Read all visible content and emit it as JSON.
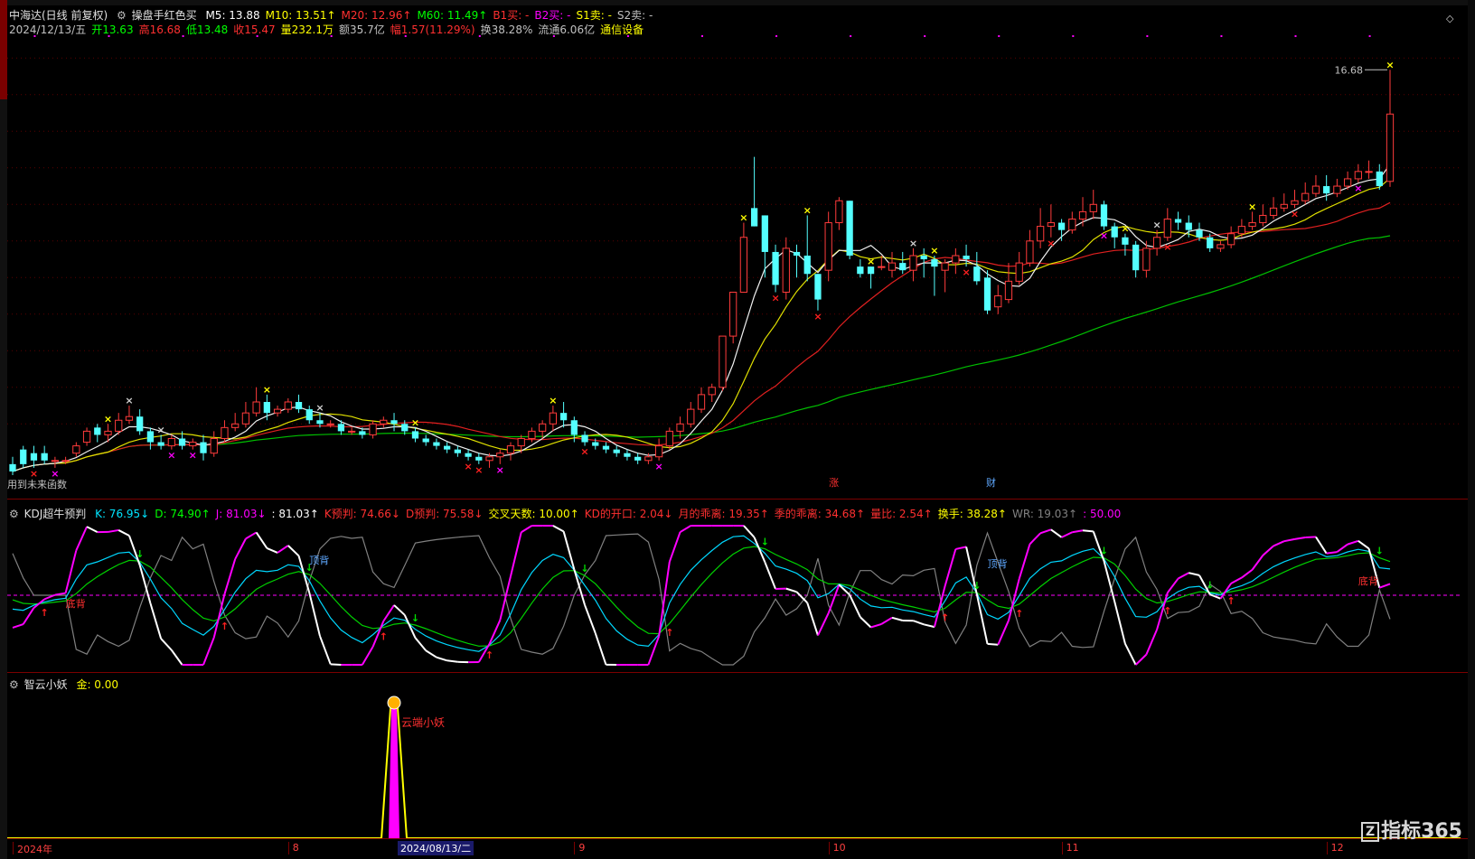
{
  "header": {
    "title": "中海达(日线 前复权)",
    "formula_name": "操盘手红色买",
    "ma": [
      {
        "label": "M5: 13.88",
        "color": "#ffffff"
      },
      {
        "label": "M10: 13.51",
        "arrow": "↑",
        "color": "#ffff00"
      },
      {
        "label": "M20: 12.96",
        "arrow": "↑",
        "color": "#ff3030"
      },
      {
        "label": "M60: 11.49",
        "arrow": "↑",
        "color": "#00ff00"
      },
      {
        "label": "B1买: -",
        "color": "#ff3030"
      },
      {
        "label": "B2买: -",
        "color": "#ff00ff"
      },
      {
        "label": "S1卖: -",
        "color": "#ffff00"
      },
      {
        "label": "S2卖: -",
        "color": "#c0c0c0"
      }
    ],
    "quote": [
      {
        "label": "2024/12/13/五",
        "color": "#c0c0c0"
      },
      {
        "label": "开13.63",
        "color": "#00ff00"
      },
      {
        "label": "高16.68",
        "color": "#ff3030"
      },
      {
        "label": "低13.48",
        "color": "#00ff00"
      },
      {
        "label": "收15.47",
        "color": "#ff3030"
      },
      {
        "label": "量232.1万",
        "color": "#ffff00"
      },
      {
        "label": "额35.7亿",
        "color": "#c0c0c0"
      },
      {
        "label": "幅1.57(11.29%)",
        "color": "#ff3030"
      },
      {
        "label": "换38.28%",
        "color": "#c0c0c0"
      },
      {
        "label": "流通6.06亿",
        "color": "#c0c0c0"
      },
      {
        "label": "通信设备",
        "color": "#ffff00"
      }
    ],
    "high_label": "16.68",
    "bottom_left_note": "用到未来函数"
  },
  "kdj_panel": {
    "name": "KDJ超牛预判",
    "items": [
      {
        "label": "K: 76.95",
        "arrow": "↓",
        "color": "#00e5ff"
      },
      {
        "label": "D: 74.90",
        "arrow": "↑",
        "color": "#00ff00"
      },
      {
        "label": "J: 81.03",
        "arrow": "↓",
        "color": "#ff00ff"
      },
      {
        "label": ": 81.03",
        "arrow": "↑",
        "color": "#ffffff"
      },
      {
        "label": "K预判: 74.66",
        "arrow": "↓",
        "color": "#ff3030"
      },
      {
        "label": "D预判: 75.58",
        "arrow": "↓",
        "color": "#ff3030"
      },
      {
        "label": "交叉天数: 10.00",
        "arrow": "↑",
        "color": "#ffff00"
      },
      {
        "label": "KD的开口: 2.04",
        "arrow": "↓",
        "color": "#ff3030"
      },
      {
        "label": "月的乖离: 19.35",
        "arrow": "↑",
        "color": "#ff3030"
      },
      {
        "label": "季的乖离: 34.68",
        "arrow": "↑",
        "color": "#ff3030"
      },
      {
        "label": "量比: 2.54",
        "arrow": "↑",
        "color": "#ff3030"
      },
      {
        "label": "换手: 38.28",
        "arrow": "↑",
        "color": "#ffff00"
      },
      {
        "label": "WR: 19.03",
        "arrow": "↑",
        "color": "#808080"
      },
      {
        "label": ": 50.00",
        "color": "#ff00ff"
      }
    ],
    "labels": {
      "bottom_div": "底背",
      "top_div": "顶背"
    }
  },
  "zy_panel": {
    "name": "智云小妖",
    "value": "金: 0.00",
    "signal_label": "云端小妖"
  },
  "markers": {
    "zhang": "涨",
    "cai": "财"
  },
  "x_axis": {
    "labels": [
      {
        "text": "2024年",
        "bar": 0
      },
      {
        "text": "8",
        "bar": 26
      },
      {
        "text": "9",
        "bar": 53
      },
      {
        "text": "10",
        "bar": 77
      },
      {
        "text": "11",
        "bar": 99
      },
      {
        "text": "12",
        "bar": 124
      }
    ],
    "cursor_label": "2024/08/13/二"
  },
  "watermark": "指标365",
  "chart_data": {
    "type": "candlestick",
    "title": "中海达(日线 前复权)",
    "ylim": [
      5.6,
      17.6
    ],
    "candles": [
      [
        5.9,
        5.7,
        6.1,
        5.6
      ],
      [
        6.3,
        5.9,
        6.4,
        5.8
      ],
      [
        6.2,
        6.0,
        6.4,
        5.8
      ],
      [
        6.2,
        6.0,
        6.4,
        5.9
      ],
      [
        6.0,
        6.0,
        6.1,
        5.8
      ],
      [
        6.0,
        6.0,
        6.1,
        5.9
      ],
      [
        6.2,
        6.4,
        6.5,
        6.1
      ],
      [
        6.5,
        6.8,
        6.9,
        6.4
      ],
      [
        6.9,
        6.7,
        7.0,
        6.5
      ],
      [
        6.7,
        6.8,
        7.0,
        6.5
      ],
      [
        6.8,
        7.1,
        7.3,
        6.7
      ],
      [
        7.1,
        7.2,
        7.5,
        7.0
      ],
      [
        7.2,
        6.8,
        7.4,
        6.7
      ],
      [
        6.8,
        6.5,
        6.9,
        6.3
      ],
      [
        6.5,
        6.4,
        6.7,
        6.3
      ],
      [
        6.4,
        6.6,
        6.7,
        6.3
      ],
      [
        6.6,
        6.4,
        6.8,
        6.3
      ],
      [
        6.4,
        6.5,
        6.6,
        6.3
      ],
      [
        6.5,
        6.2,
        6.7,
        6.0
      ],
      [
        6.2,
        6.6,
        6.8,
        6.1
      ],
      [
        6.6,
        6.9,
        7.1,
        6.5
      ],
      [
        6.9,
        7.0,
        7.3,
        6.8
      ],
      [
        7.0,
        7.3,
        7.6,
        6.9
      ],
      [
        7.3,
        7.6,
        8.0,
        7.2
      ],
      [
        7.6,
        7.3,
        7.8,
        7.1
      ],
      [
        7.3,
        7.4,
        7.5,
        7.2
      ],
      [
        7.4,
        7.6,
        7.7,
        7.3
      ],
      [
        7.6,
        7.4,
        7.8,
        7.3
      ],
      [
        7.4,
        7.1,
        7.5,
        7.0
      ],
      [
        7.1,
        7.0,
        7.3,
        6.9
      ],
      [
        7.0,
        7.0,
        7.1,
        6.9
      ],
      [
        7.0,
        6.8,
        7.1,
        6.7
      ],
      [
        6.8,
        6.8,
        6.9,
        6.7
      ],
      [
        6.8,
        6.7,
        6.9,
        6.6
      ],
      [
        6.7,
        7.0,
        7.1,
        6.6
      ],
      [
        7.0,
        7.1,
        7.2,
        6.9
      ],
      [
        7.1,
        7.0,
        7.3,
        6.8
      ],
      [
        7.0,
        6.8,
        7.1,
        6.7
      ],
      [
        6.8,
        6.6,
        6.9,
        6.5
      ],
      [
        6.6,
        6.5,
        6.7,
        6.4
      ],
      [
        6.5,
        6.4,
        6.6,
        6.3
      ],
      [
        6.4,
        6.3,
        6.5,
        6.2
      ],
      [
        6.3,
        6.2,
        6.4,
        6.1
      ],
      [
        6.2,
        6.1,
        6.3,
        6.0
      ],
      [
        6.1,
        6.0,
        6.2,
        5.9
      ],
      [
        6.0,
        6.1,
        6.2,
        5.8
      ],
      [
        6.1,
        6.2,
        6.3,
        5.9
      ],
      [
        6.2,
        6.4,
        6.5,
        6.0
      ],
      [
        6.4,
        6.6,
        6.7,
        6.2
      ],
      [
        6.6,
        6.8,
        6.9,
        6.5
      ],
      [
        6.8,
        7.0,
        7.1,
        6.6
      ],
      [
        7.0,
        7.3,
        7.5,
        6.8
      ],
      [
        7.3,
        7.1,
        7.6,
        6.9
      ],
      [
        7.1,
        6.7,
        7.2,
        6.5
      ],
      [
        6.7,
        6.5,
        6.8,
        6.4
      ],
      [
        6.5,
        6.4,
        6.6,
        6.3
      ],
      [
        6.4,
        6.3,
        6.5,
        6.2
      ],
      [
        6.3,
        6.2,
        6.4,
        6.1
      ],
      [
        6.2,
        6.1,
        6.3,
        6.0
      ],
      [
        6.1,
        6.0,
        6.2,
        5.9
      ],
      [
        6.0,
        6.1,
        6.2,
        5.9
      ],
      [
        6.1,
        6.4,
        6.6,
        6.0
      ],
      [
        6.4,
        6.8,
        6.9,
        6.3
      ],
      [
        6.8,
        7.0,
        7.2,
        6.6
      ],
      [
        7.0,
        7.4,
        7.6,
        6.9
      ],
      [
        7.4,
        7.8,
        8.0,
        7.3
      ],
      [
        7.8,
        8.0,
        8.1,
        7.6
      ],
      [
        8.0,
        9.4,
        9.4,
        7.9
      ],
      [
        9.4,
        10.6,
        10.6,
        9.2
      ],
      [
        10.6,
        12.1,
        12.5,
        10.6
      ],
      [
        12.9,
        12.4,
        14.3,
        12.4
      ],
      [
        12.7,
        11.7,
        12.7,
        11.0
      ],
      [
        11.7,
        10.8,
        11.9,
        10.6
      ],
      [
        10.6,
        11.8,
        12.1,
        10.4
      ],
      [
        11.7,
        11.6,
        11.9,
        11.0
      ],
      [
        11.6,
        11.1,
        12.7,
        10.9
      ],
      [
        11.1,
        10.4,
        11.1,
        10.1
      ],
      [
        11.2,
        12.5,
        12.8,
        10.9
      ],
      [
        12.5,
        13.1,
        13.2,
        12.3
      ],
      [
        13.1,
        11.6,
        13.1,
        11.5
      ],
      [
        11.3,
        11.1,
        11.5,
        11.0
      ],
      [
        11.3,
        11.1,
        11.3,
        10.7
      ],
      [
        11.3,
        11.3,
        11.6,
        11.2
      ],
      [
        11.2,
        11.4,
        11.7,
        11.0
      ],
      [
        11.4,
        11.2,
        11.7,
        11.1
      ],
      [
        11.2,
        11.6,
        11.8,
        10.9
      ],
      [
        11.6,
        11.5,
        11.8,
        11.0
      ],
      [
        11.5,
        11.3,
        11.6,
        10.5
      ],
      [
        11.2,
        11.4,
        11.5,
        10.6
      ],
      [
        11.4,
        11.6,
        11.8,
        11.1
      ],
      [
        11.6,
        11.5,
        11.9,
        11.3
      ],
      [
        11.3,
        10.9,
        11.7,
        10.8
      ],
      [
        11.0,
        10.1,
        11.2,
        10.0
      ],
      [
        10.2,
        10.5,
        10.8,
        10.0
      ],
      [
        10.4,
        10.9,
        11.4,
        10.3
      ],
      [
        10.9,
        11.4,
        11.7,
        10.8
      ],
      [
        11.4,
        12.0,
        12.3,
        11.3
      ],
      [
        12.0,
        12.4,
        12.9,
        11.8
      ],
      [
        12.4,
        12.5,
        13.0,
        12.1
      ],
      [
        12.5,
        12.3,
        12.6,
        12.0
      ],
      [
        12.3,
        12.6,
        12.8,
        12.2
      ],
      [
        12.6,
        12.8,
        13.2,
        12.4
      ],
      [
        12.8,
        13.0,
        13.4,
        12.6
      ],
      [
        13.0,
        12.4,
        13.1,
        12.3
      ],
      [
        12.4,
        12.1,
        12.5,
        11.8
      ],
      [
        12.1,
        11.9,
        12.2,
        11.6
      ],
      [
        11.9,
        11.2,
        12.0,
        11.0
      ],
      [
        11.2,
        11.8,
        12.0,
        11.0
      ],
      [
        11.8,
        12.1,
        12.3,
        11.6
      ],
      [
        12.1,
        12.6,
        12.9,
        12.0
      ],
      [
        12.6,
        12.5,
        12.8,
        12.3
      ],
      [
        12.5,
        12.3,
        12.7,
        12.1
      ],
      [
        12.3,
        12.1,
        12.5,
        12.0
      ],
      [
        12.1,
        11.8,
        12.2,
        11.7
      ],
      [
        11.8,
        11.9,
        12.0,
        11.7
      ],
      [
        11.9,
        12.2,
        12.4,
        11.8
      ],
      [
        12.2,
        12.4,
        12.6,
        12.1
      ],
      [
        12.4,
        12.5,
        12.8,
        12.3
      ],
      [
        12.5,
        12.7,
        13.0,
        12.4
      ],
      [
        12.7,
        12.9,
        13.2,
        12.6
      ],
      [
        12.9,
        13.0,
        13.3,
        12.8
      ],
      [
        13.0,
        13.1,
        13.4,
        12.9
      ],
      [
        13.1,
        13.3,
        13.6,
        13.0
      ],
      [
        13.3,
        13.5,
        13.8,
        13.2
      ],
      [
        13.5,
        13.3,
        13.8,
        13.1
      ],
      [
        13.3,
        13.5,
        13.7,
        13.2
      ],
      [
        13.5,
        13.7,
        13.9,
        13.4
      ],
      [
        13.7,
        13.9,
        14.1,
        13.6
      ],
      [
        13.9,
        13.9,
        14.2,
        13.7
      ],
      [
        13.9,
        13.5,
        14.1,
        13.4
      ],
      [
        13.63,
        15.47,
        16.68,
        13.48
      ]
    ],
    "indicators": {
      "kdj": {
        "K": 76.95,
        "D": 74.9,
        "J": 81.03,
        "K_pred": 74.66,
        "D_pred": 75.58
      },
      "jin": 0.0
    }
  }
}
